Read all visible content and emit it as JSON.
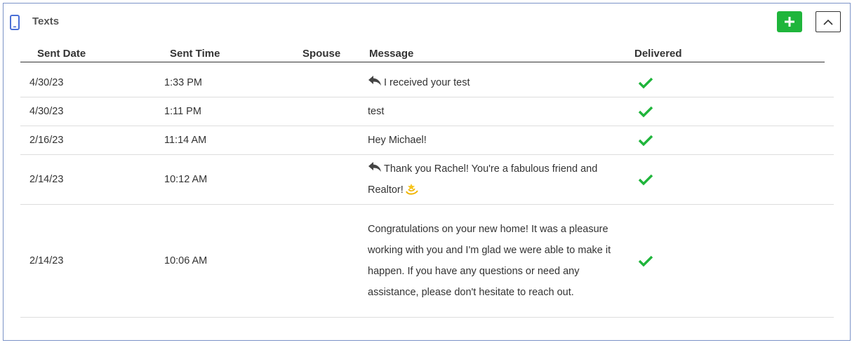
{
  "panel": {
    "title": "Texts",
    "icons": {
      "header": "mobile-phone-icon",
      "add": "plus-icon",
      "collapse": "chevron-up-icon"
    },
    "colors": {
      "accent_blue": "#4a6fd6",
      "add_green": "#1fb53b",
      "check_green": "#1fb53b",
      "border": "#7b93c7"
    }
  },
  "table": {
    "columns": [
      "Sent Date",
      "Sent Time",
      "Spouse",
      "Message",
      "Delivered"
    ],
    "rows": [
      {
        "date": "4/30/23",
        "time": "1:33 PM",
        "spouse": "",
        "reply": true,
        "message": "I received your test",
        "delivered": true
      },
      {
        "date": "4/30/23",
        "time": "1:11 PM",
        "spouse": "",
        "reply": false,
        "message": "test",
        "delivered": true
      },
      {
        "date": "2/16/23",
        "time": "11:14 AM",
        "spouse": "",
        "reply": false,
        "message": "Hey Michael!",
        "delivered": true
      },
      {
        "date": "2/14/23",
        "time": "10:12 AM",
        "spouse": "",
        "reply": true,
        "message": "Thank you Rachel! You're a fabulous friend and Realtor!",
        "emoji": "dizzy-star-icon",
        "delivered": true
      },
      {
        "date": "2/14/23",
        "time": "10:06 AM",
        "spouse": "",
        "reply": false,
        "message": "Congratulations on your new home! It was a pleasure working with you and I'm glad we were able to make it happen. If you have any questions or need any assistance, please don't hesitate to reach out.",
        "delivered": true
      }
    ]
  }
}
